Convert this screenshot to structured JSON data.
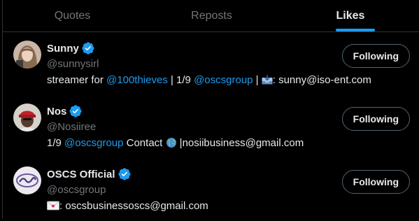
{
  "tabs": [
    {
      "label": "Quotes",
      "active": false
    },
    {
      "label": "Reposts",
      "active": false
    },
    {
      "label": "Likes",
      "active": true
    }
  ],
  "users": [
    {
      "display_name": "Sunny",
      "handle": "@sunnysirl",
      "verified": true,
      "follow_label": "Following",
      "avatar_icon": "woman-selfie-avatar",
      "bio": {
        "t1": "streamer for ",
        "m1": "@100thieves",
        "t2": " | 1/9 ",
        "m2": "@oscsgroup",
        "t3": " | ",
        "emoji": "inbox-tray-icon",
        "t4": ": sunny@iso-ent.com"
      }
    },
    {
      "display_name": "Nos",
      "handle": "@Nosiiree",
      "verified": true,
      "follow_label": "Following",
      "avatar_icon": "red-cap-avatar",
      "bio": {
        "t1": "1/9 ",
        "m1": "@oscsgroup",
        "t2": " Contact ",
        "emoji": "globe-icon",
        "t3": " |nosiibusiness@gmail.com"
      }
    },
    {
      "display_name": "OSCS Official",
      "handle": "@oscsgroup",
      "verified": true,
      "follow_label": "Following",
      "avatar_icon": "oscs-logo-avatar",
      "bio": {
        "emoji": "love-letter-icon",
        "t1": ": oscsbusinessoscs@gmail.com"
      }
    }
  ],
  "colors": {
    "accent": "#1d9bf0",
    "background": "#000000",
    "text_primary": "#e7e9ea",
    "text_secondary": "#71767b",
    "border": "#2f3336"
  }
}
